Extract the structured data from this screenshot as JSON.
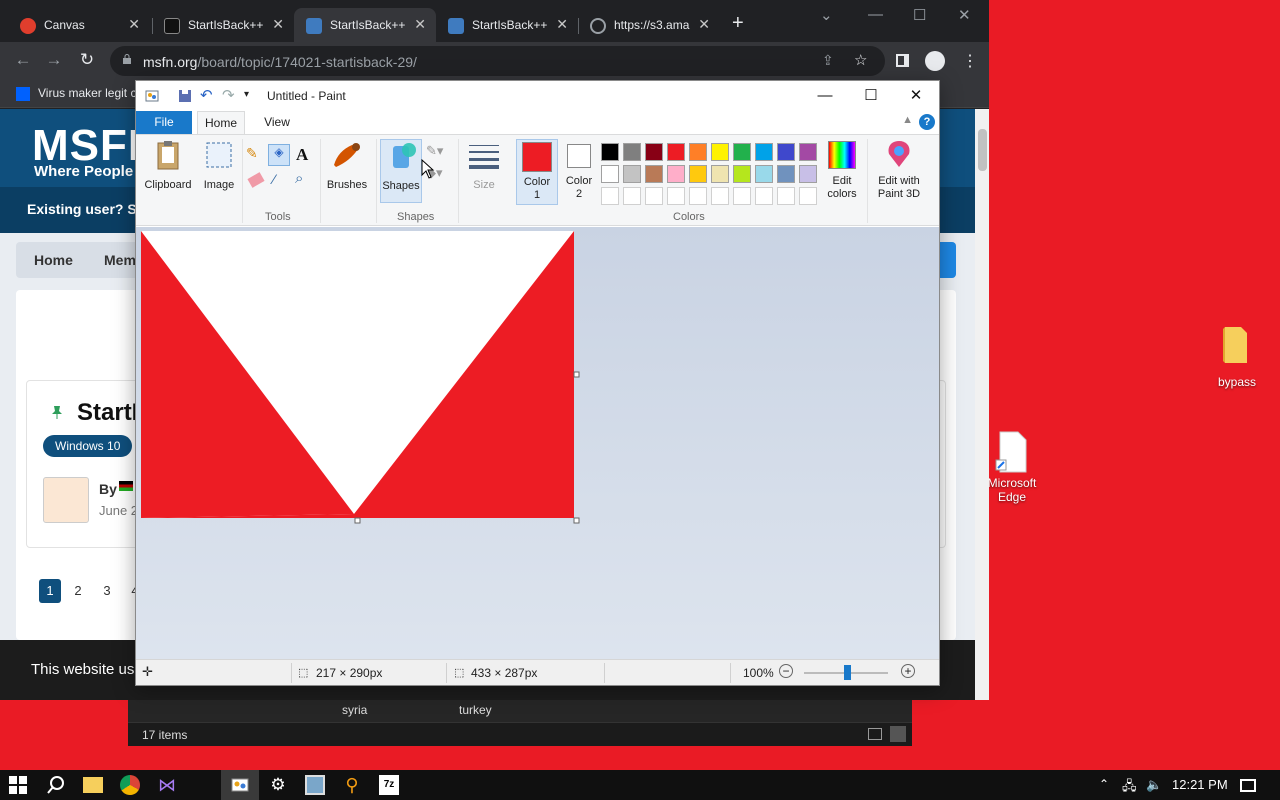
{
  "desktop": {
    "icons": [
      {
        "label": "bypass"
      },
      {
        "label": "Microsoft Edge"
      }
    ]
  },
  "explorer": {
    "tags": [
      "syria",
      "turkey"
    ],
    "item_count": "17 items"
  },
  "browser": {
    "tabs": [
      {
        "title": "Canvas"
      },
      {
        "title": "StartIsBack++"
      },
      {
        "title": "StartIsBack++"
      },
      {
        "title": "StartIsBack++"
      },
      {
        "title": "https://s3.ama"
      }
    ],
    "url_domain": "msfn.org",
    "url_path": "/board/topic/174021-startisback-29/",
    "bookmark": "Virus maker legit c"
  },
  "page": {
    "logo": "MSFN",
    "tagline": "Where People",
    "existing_user": "Existing user? Sign",
    "breadcrumbs": [
      "Home",
      "Mem"
    ],
    "topic_title": "StartI",
    "badge": "Windows 10",
    "author_by": "By",
    "date": "June 2",
    "pages": [
      "1",
      "2",
      "3",
      "4"
    ],
    "cookie_text": "This website us"
  },
  "paint": {
    "title": "Untitled - Paint",
    "tabs": {
      "file": "File",
      "home": "Home",
      "view": "View"
    },
    "groups": {
      "clipboard": "Clipboard",
      "image": "Image",
      "tools": "Tools",
      "brushes": "Brushes",
      "shapes": "Shapes",
      "shapes_group": "Shapes",
      "size": "Size",
      "color1": "Color 1",
      "color2": "Color 2",
      "colors": "Colors",
      "edit_colors": "Edit colors",
      "edit_3d": "Edit with Paint 3D"
    },
    "palette": [
      "#000000",
      "#7f7f7f",
      "#880015",
      "#ed1c24",
      "#ff7f27",
      "#fff200",
      "#22b14c",
      "#00a2e8",
      "#3f48cc",
      "#a349a4",
      "#ffffff",
      "#c3c3c3",
      "#b97a57",
      "#ffaec9",
      "#ffc90e",
      "#efe4b0",
      "#b5e61d",
      "#99d9ea",
      "#7092be",
      "#c8bfe7"
    ],
    "color1_value": "#ed1c24",
    "color2_value": "#ffffff",
    "status": {
      "cursor_pos": "217 × 290px",
      "image_size": "433 × 287px",
      "zoom": "100%"
    }
  },
  "taskbar": {
    "time": "12:21 PM"
  }
}
